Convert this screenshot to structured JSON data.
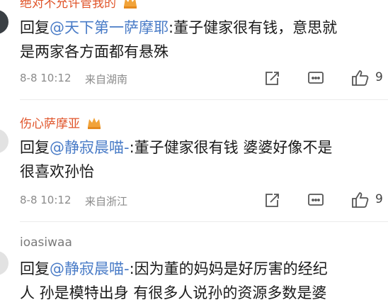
{
  "comments": [
    {
      "username": "绝对不允许管我的",
      "reply_prefix": "回复",
      "mention": "@天下第一萨摩耶",
      "text_line1": ":董子健家很有钱，意思就",
      "text_line2": "是两家各方面都有悬殊",
      "time": "8-8 10:12",
      "location": "来自湖南",
      "likes": "9"
    },
    {
      "username": "伤心萨摩亚",
      "reply_prefix": "回复",
      "mention": "@静寂晨喵-",
      "text_line1": ":董子健家很有钱 婆婆好像不是",
      "text_line2": "很喜欢孙怡",
      "time": "8-8 10:12",
      "location": "来自浙江",
      "likes": "9"
    },
    {
      "username": "ioasiwaa",
      "reply_prefix": "回复",
      "mention": "@静寂晨喵-",
      "text_line1": ":因为董的妈妈是好厉害的经纪",
      "text_line2": "人 孙是模特出身 有很多人说孙的资源多数是婆"
    }
  ],
  "icons": {
    "share": "share-edit-icon",
    "comment": "comment-icon",
    "like": "thumbs-up-icon",
    "vip": "crown-icon"
  },
  "colors": {
    "vip_username": "#e0552b",
    "mention": "#4a7cc7",
    "meta": "#8b8b8b"
  }
}
